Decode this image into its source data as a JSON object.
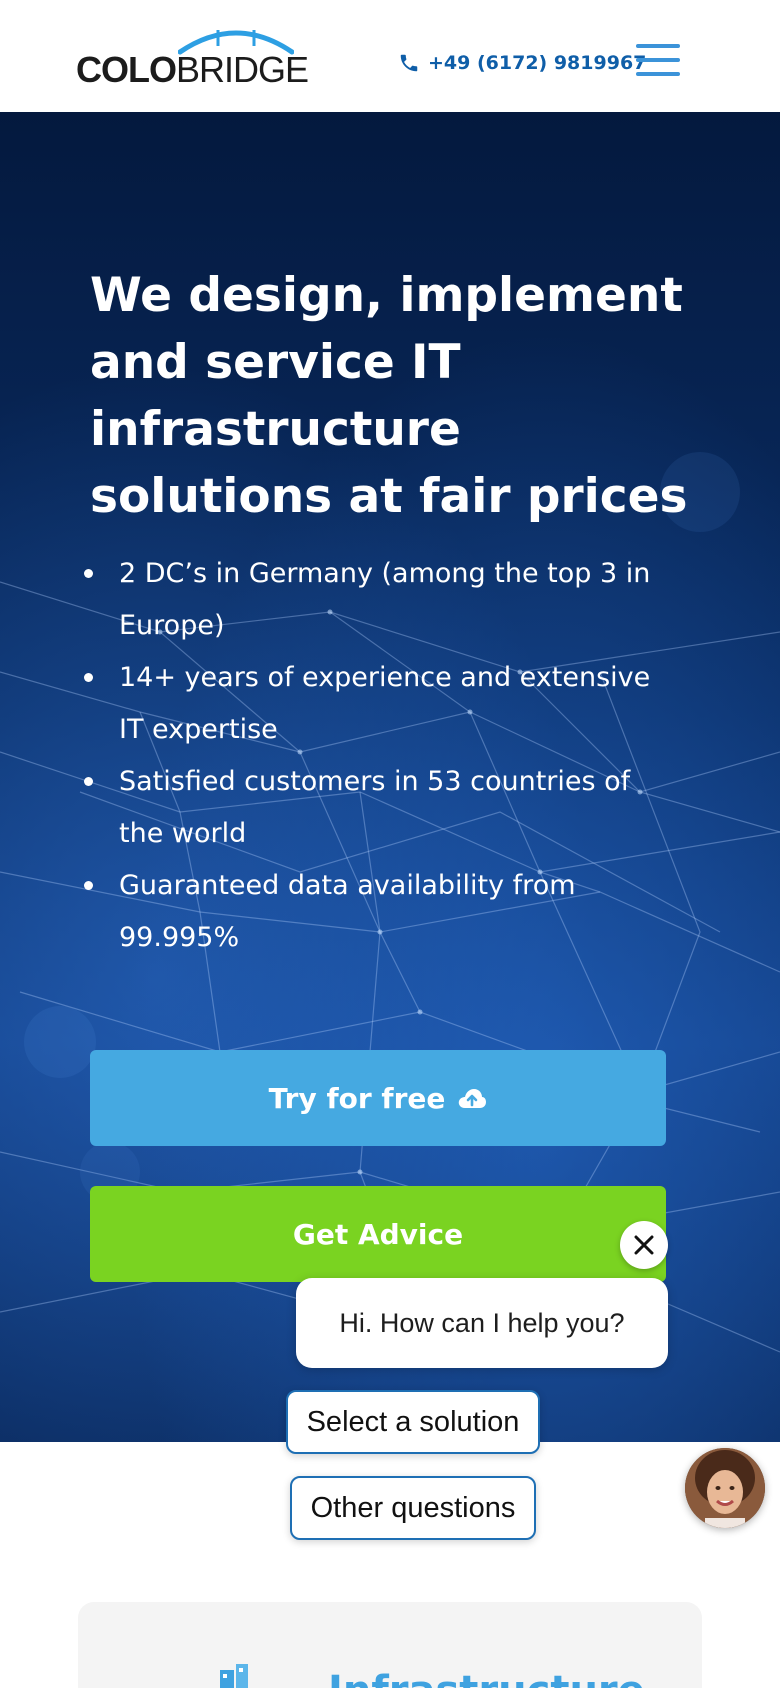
{
  "header": {
    "logo": {
      "part1": "COLO",
      "part2": "BRIDGE"
    },
    "phone": "+49 (6172) 9819967",
    "phone_icon": "phone-icon",
    "menu_icon": "hamburger-menu-icon"
  },
  "hero": {
    "title": "We design, implement and service IT infrastructure solutions at fair prices",
    "bullets": [
      "2 DC’s in Germany (among the top 3 in Europe)",
      "14+ years of experience and extensive IT expertise",
      "Satisfied customers in 53 countries of the world",
      "Guaranteed data availability from 99.995%"
    ],
    "try_button": "Try for free",
    "try_icon": "cloud-upload-icon",
    "advice_button": "Get Advice"
  },
  "chat": {
    "greeting": "Hi. How can I help you?",
    "options": [
      "Select a solution",
      "Other questions"
    ],
    "close_icon": "close-icon",
    "avatar": "agent-avatar"
  },
  "card": {
    "title": "Infrastructure",
    "icon": "infrastructure-icon"
  },
  "colors": {
    "primary_blue": "#45a9e1",
    "green": "#7ad321",
    "hero_dark": "#0a2e66",
    "link_blue": "#0f5ea8"
  }
}
